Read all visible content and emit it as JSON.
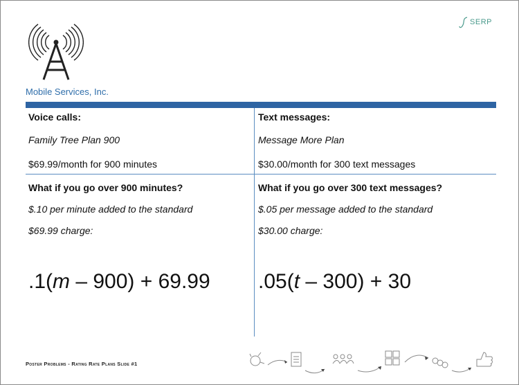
{
  "header": {
    "company": "Mobile Services, Inc.",
    "logo_text": "SERP"
  },
  "voice": {
    "heading": "Voice calls:",
    "plan": "Family Tree Plan 900",
    "price": "$69.99/month for 900 minutes",
    "question": "What if you go over 900 minutes?",
    "note_line1": "$.10 per minute added to the standard",
    "note_line2": "$69.99 charge:",
    "formula_pre": ".1(",
    "formula_var": "m",
    "formula_post": " – 900) + 69.99"
  },
  "text": {
    "heading": "Text messages:",
    "plan": "Message More Plan",
    "price": "$30.00/month for 300 text messages",
    "question": "What if you go over 300 text messages?",
    "note_line1": "$.05 per message added to the standard",
    "note_line2": "$30.00 charge:",
    "formula_pre": ".05(",
    "formula_var": "t",
    "formula_post": " – 300) + 30"
  },
  "footer": {
    "caption": "Poster Problems - Rating Rate Plans Slide #1"
  },
  "icons": [
    "radio-tower-icon",
    "serp-logo-icon",
    "process-strip-icon"
  ],
  "colors": {
    "accent": "#2e64a3",
    "company": "#2f6eaa",
    "logo": "#4a9a8c"
  }
}
